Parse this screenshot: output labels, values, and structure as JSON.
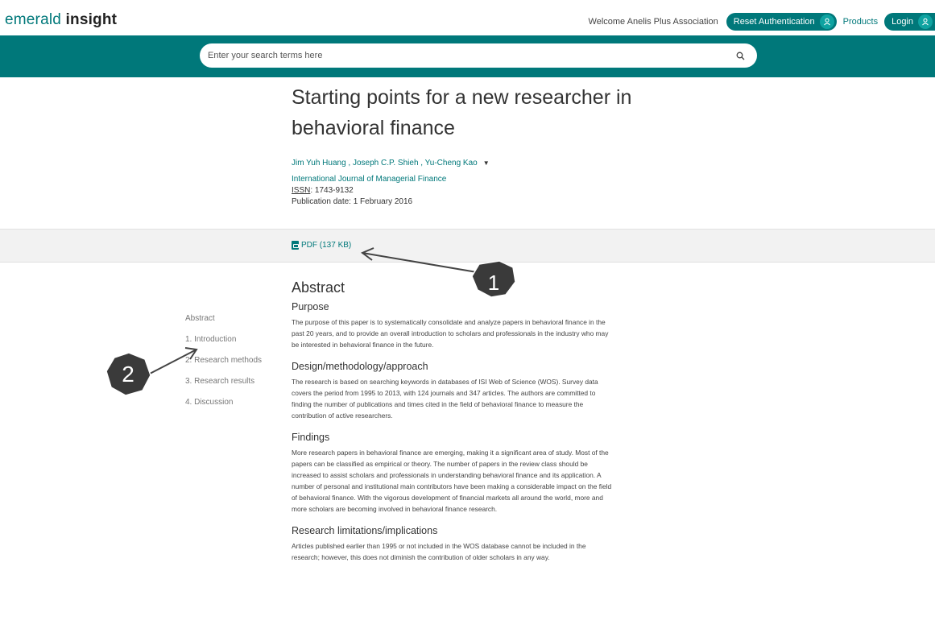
{
  "header": {
    "logo_light": "emerald",
    "logo_bold": "insight",
    "welcome": "Welcome Anelis Plus Association",
    "reset_label": "Reset Authentication",
    "products_label": "Products",
    "login_label": "Login"
  },
  "search": {
    "placeholder": "Enter your search terms here"
  },
  "article": {
    "title": "Starting points for a new researcher in behavioral finance",
    "authors": "Jim Yuh Huang , Joseph C.P. Shieh , Yu-Cheng Kao",
    "journal": "International Journal of Managerial Finance",
    "issn_label": "ISSN",
    "issn_value": ": 1743-9132",
    "pub_date": "Publication date: 1 February 2016",
    "pdf_label": "PDF (137 KB)"
  },
  "toc": {
    "items": [
      "Abstract",
      "1. Introduction",
      "2. Research methods",
      "3. Research results",
      "4. Discussion"
    ]
  },
  "abstract": {
    "heading": "Abstract",
    "sections": [
      {
        "title": "Purpose",
        "text": "The purpose of this paper is to systematically consolidate and analyze papers in behavioral finance in the past 20 years, and to provide an overall introduction to scholars and professionals in the industry who may be interested in behavioral finance in the future."
      },
      {
        "title": "Design/methodology/approach",
        "text": "The research is based on searching keywords in databases of ISI Web of Science (WOS). Survey data covers the period from 1995 to 2013, with 124 journals and 347 articles. The authors are committed to finding the number of publications and times cited in the field of behavioral finance to measure the contribution of active researchers."
      },
      {
        "title": "Findings",
        "text": "More research papers in behavioral finance are emerging, making it a significant area of study. Most of the papers can be classified as empirical or theory. The number of papers in the review class should be increased to assist scholars and professionals in understanding behavioral finance and its application. A number of personal and institutional main contributors have been making a considerable impact on the field of behavioral finance. With the vigorous development of financial markets all around the world, more and more scholars are becoming involved in behavioral finance research."
      },
      {
        "title": "Research limitations/implications",
        "text": "Articles published earlier than 1995 or not included in the WOS database cannot be included in the research; however, this does not diminish the contribution of older scholars in any way."
      }
    ]
  },
  "annotations": {
    "badge1": "1",
    "badge2": "2"
  },
  "colors": {
    "brand": "#00787a",
    "badge": "#3a3a3a"
  }
}
